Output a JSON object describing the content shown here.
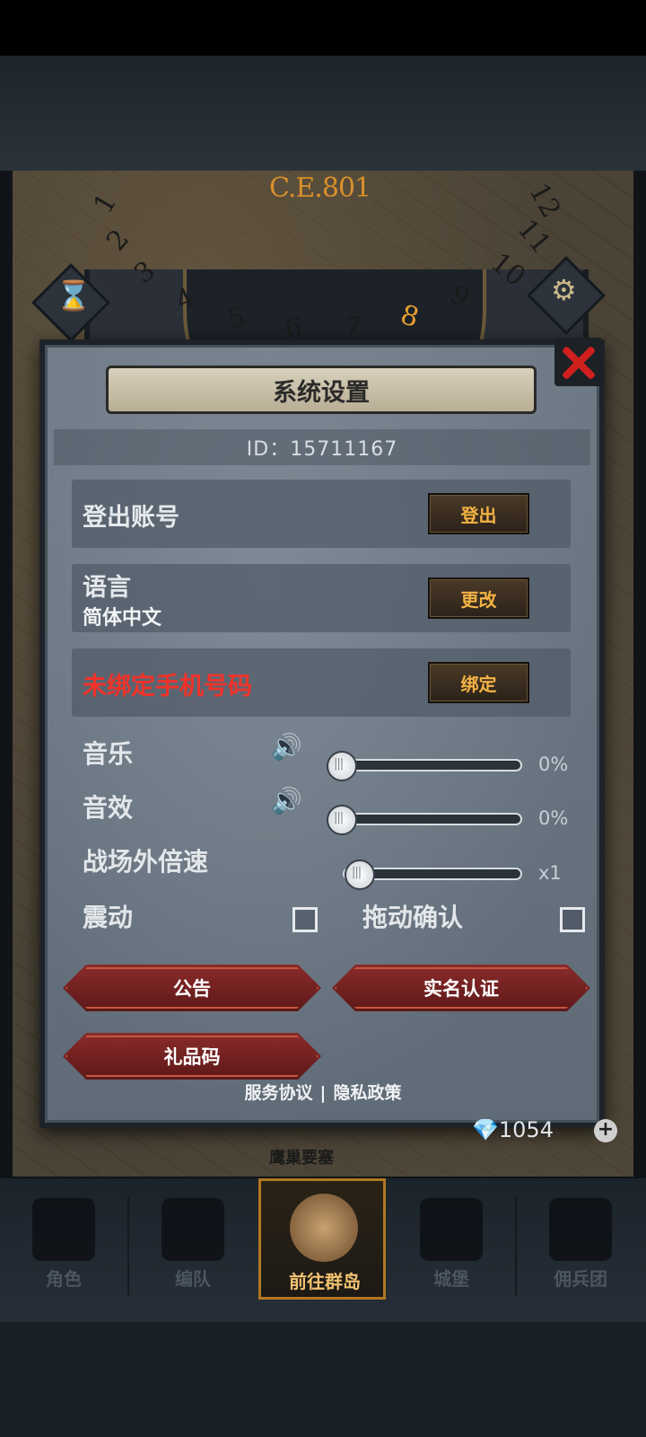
{
  "map": {
    "era": "C.E.801",
    "wheel_numbers": [
      "1",
      "2",
      "3",
      "4",
      "5",
      "6",
      "7",
      "8",
      "9",
      "10",
      "11",
      "12"
    ],
    "active_number": "8",
    "coin_count": "1054",
    "fortress_label": "鹰巢要塞"
  },
  "dialog": {
    "title": "系统设置",
    "id_text": "ID：15711167",
    "logout": {
      "label": "登出账号",
      "button": "登出"
    },
    "language": {
      "label": "语言",
      "value": "简体中文",
      "button": "更改"
    },
    "phone": {
      "label": "未绑定手机号码",
      "button": "绑定"
    },
    "music": {
      "label": "音乐",
      "value_text": "0%",
      "level": 0
    },
    "sfx": {
      "label": "音效",
      "value_text": "0%",
      "level": 0
    },
    "speed": {
      "label": "战场外倍速",
      "value_text": "x1",
      "level": 0
    },
    "vibration": {
      "label": "震动",
      "checked": false
    },
    "drag_confirm": {
      "label": "拖动确认",
      "checked": false
    },
    "buttons": {
      "notice": "公告",
      "real_name": "实名认证",
      "gift_code": "礼品码"
    },
    "footer": {
      "service": "服务协议",
      "separator": "|",
      "privacy": "隐私政策"
    }
  },
  "bottom_nav": [
    {
      "label": "角色",
      "active": false
    },
    {
      "label": "编队",
      "active": false
    },
    {
      "label": "前往群岛",
      "active": true
    },
    {
      "label": "城堡",
      "active": false
    },
    {
      "label": "佣兵团",
      "active": false
    }
  ],
  "colors": {
    "warning_text": "#f0332a",
    "small_button_text": "#f3b344",
    "active_nav": "#f2c271",
    "close_x": "#d0201e"
  }
}
